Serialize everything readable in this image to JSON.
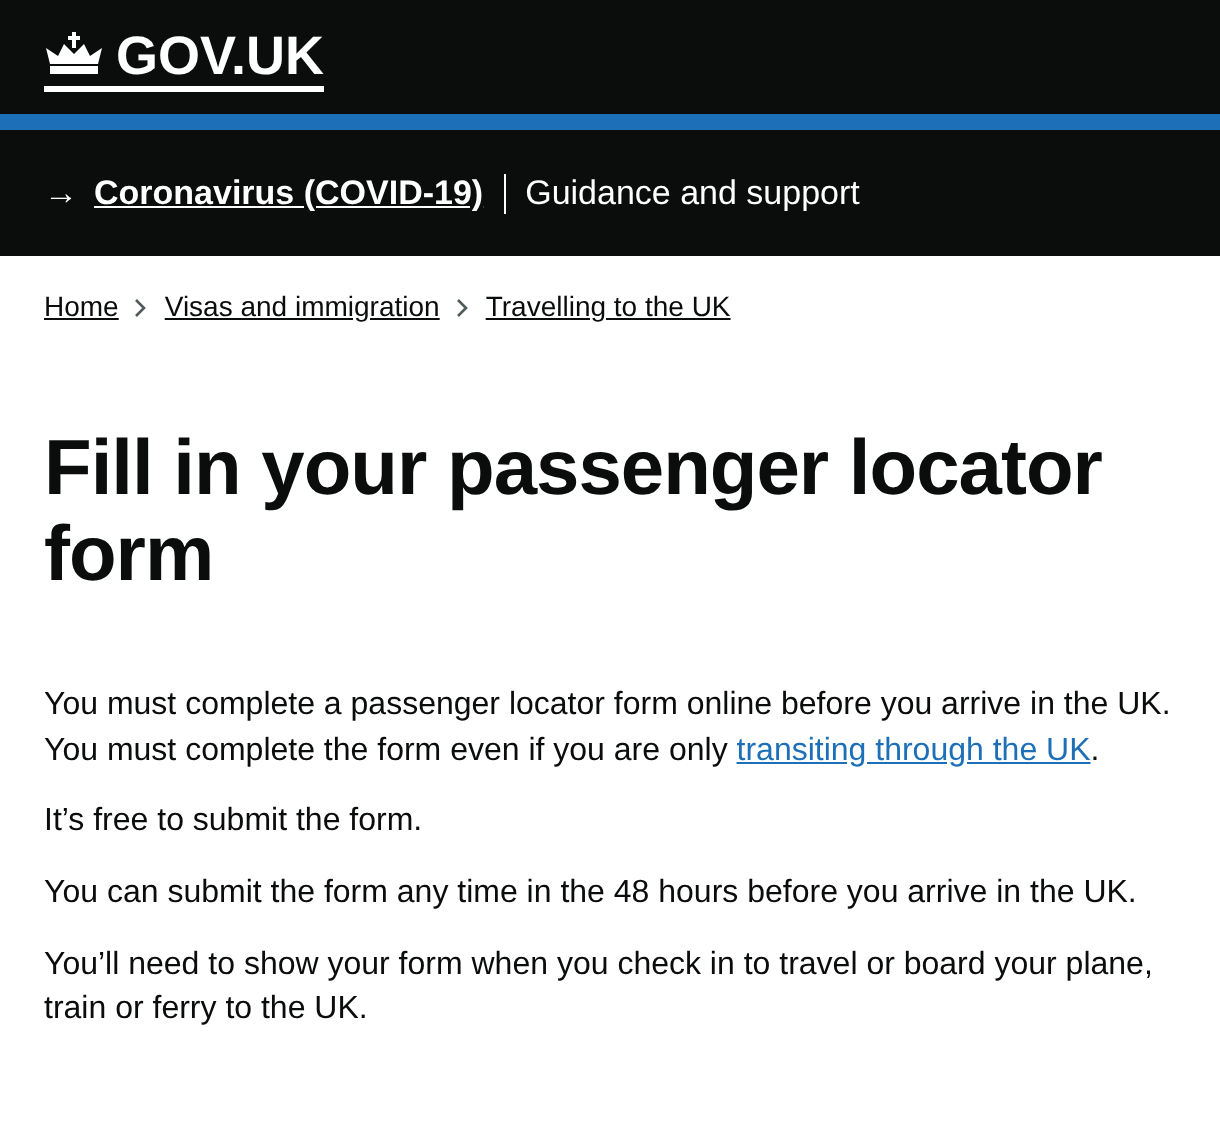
{
  "header": {
    "logo": "GOV.UK"
  },
  "banner": {
    "arrow": "→",
    "link": "Coronavirus (COVID-19)",
    "text": "Guidance and support"
  },
  "breadcrumbs": [
    {
      "label": "Home"
    },
    {
      "label": "Visas and immigration"
    },
    {
      "label": "Travelling to the UK"
    }
  ],
  "title": "Fill in your passenger locator form",
  "paragraphs": [
    {
      "text": "You must complete a passenger locator form online before you arrive in the UK. You must complete the form even if you are only ",
      "link": "transiting through the UK",
      "after": "."
    },
    {
      "text": "It’s free to submit the form."
    },
    {
      "text": "You can submit the form any time in the 48 hours before you arrive in the UK."
    },
    {
      "text": "You’ll need to show your form when you check in to travel or board your plane, train or ferry to the UK."
    }
  ]
}
